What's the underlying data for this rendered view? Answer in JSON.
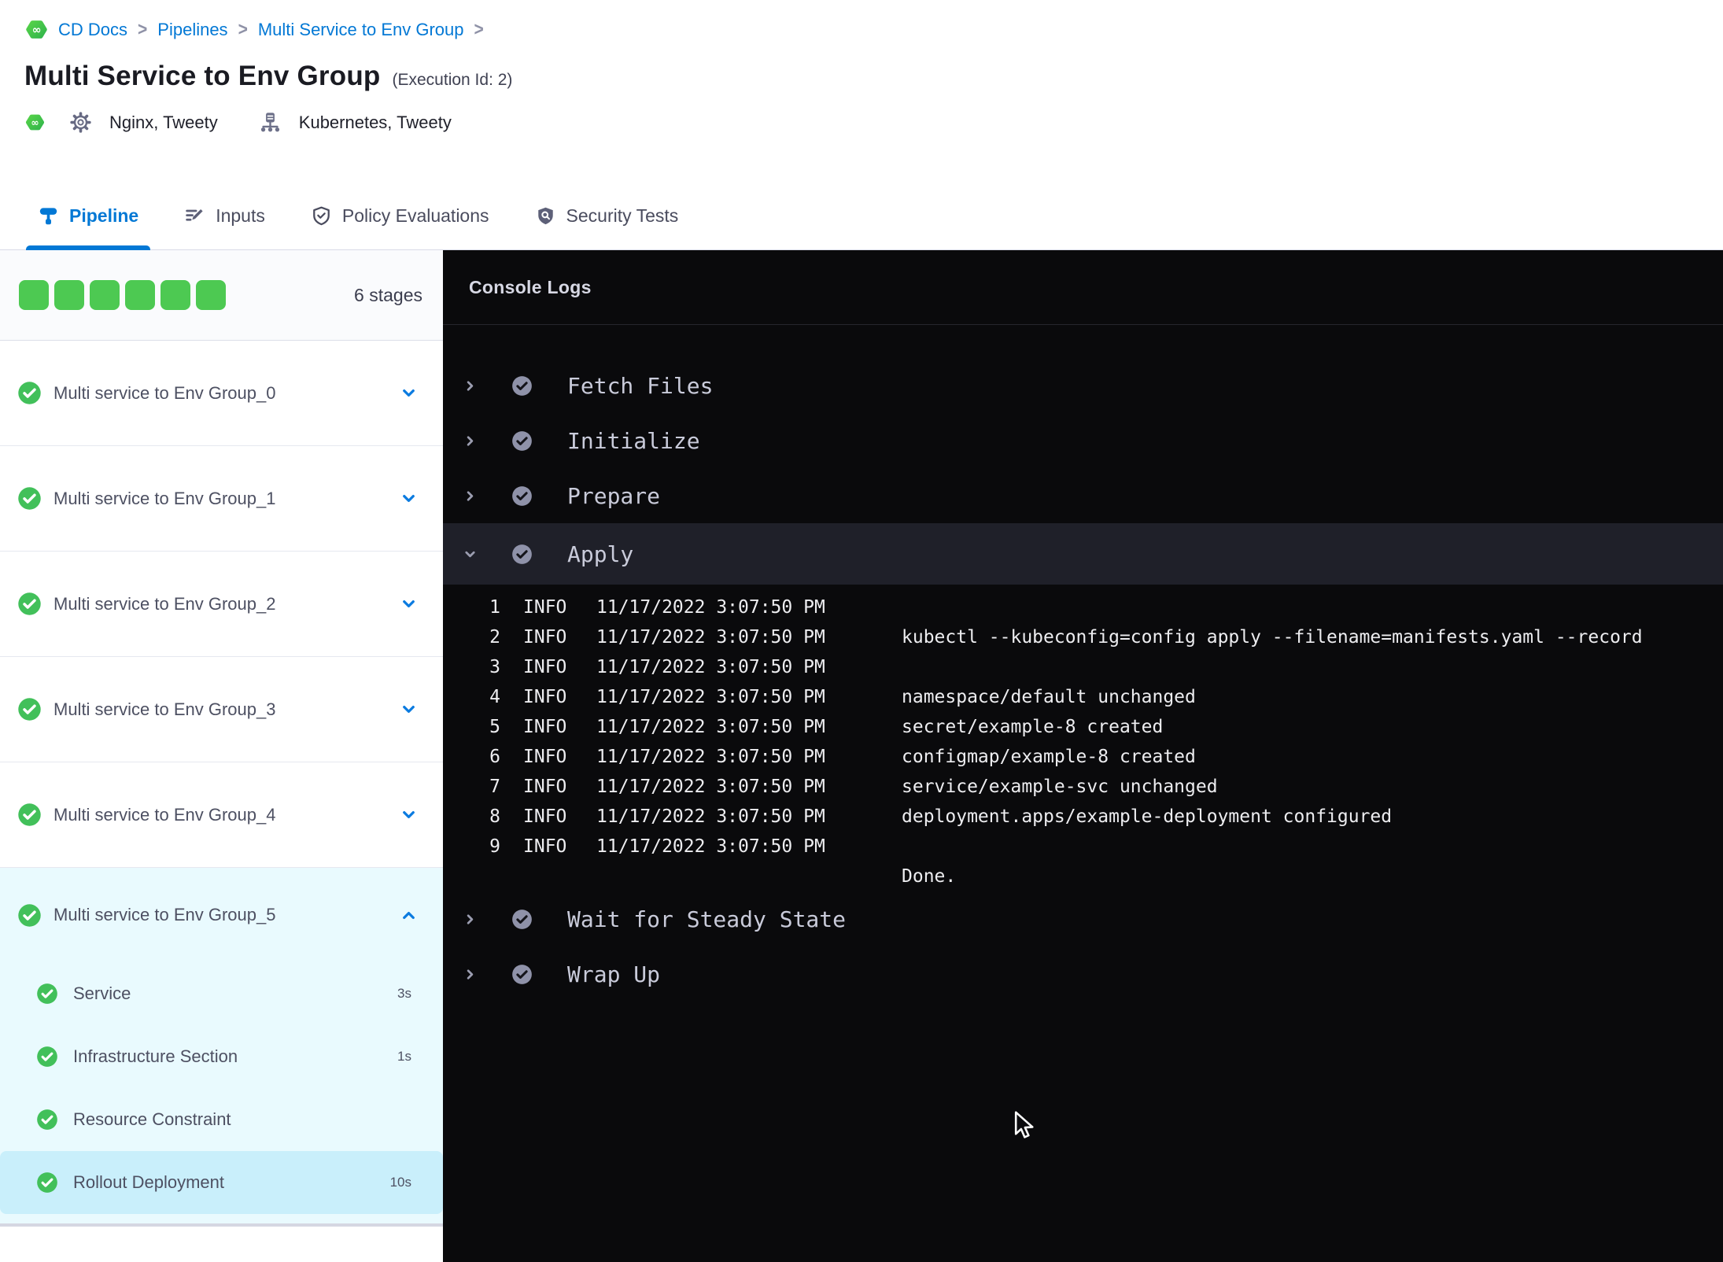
{
  "breadcrumb": {
    "items": [
      "CD Docs",
      "Pipelines",
      "Multi Service to Env Group"
    ],
    "separator": ">"
  },
  "header": {
    "title": "Multi Service to Env Group",
    "execution_id": "(Execution Id: 2)",
    "services": "Nginx, Tweety",
    "infrastructure": "Kubernetes, Tweety"
  },
  "tabs": [
    {
      "label": "Pipeline",
      "icon": "pipeline-icon",
      "active": true
    },
    {
      "label": "Inputs",
      "icon": "inputs-icon",
      "active": false
    },
    {
      "label": "Policy Evaluations",
      "icon": "shield-check-icon",
      "active": false
    },
    {
      "label": "Security Tests",
      "icon": "shield-search-icon",
      "active": false
    }
  ],
  "stages_summary": {
    "count": 6,
    "count_label": "6 stages"
  },
  "stages": [
    {
      "label": "Multi service to Env Group_0",
      "status": "success",
      "expanded": false
    },
    {
      "label": "Multi service to Env Group_1",
      "status": "success",
      "expanded": false
    },
    {
      "label": "Multi service to Env Group_2",
      "status": "success",
      "expanded": false
    },
    {
      "label": "Multi service to Env Group_3",
      "status": "success",
      "expanded": false
    },
    {
      "label": "Multi service to Env Group_4",
      "status": "success",
      "expanded": false
    },
    {
      "label": "Multi service to Env Group_5",
      "status": "success",
      "expanded": true,
      "steps": [
        {
          "label": "Service",
          "duration": "3s",
          "status": "success",
          "selected": false
        },
        {
          "label": "Infrastructure Section",
          "duration": "1s",
          "status": "success",
          "selected": false
        },
        {
          "label": "Resource Constraint",
          "duration": "",
          "status": "success",
          "selected": false
        },
        {
          "label": "Rollout Deployment",
          "duration": "10s",
          "status": "success",
          "selected": true
        }
      ]
    }
  ],
  "console": {
    "title": "Console Logs",
    "steps": [
      {
        "label": "Fetch Files",
        "status": "success",
        "expanded": false
      },
      {
        "label": "Initialize",
        "status": "success",
        "expanded": false
      },
      {
        "label": "Prepare",
        "status": "success",
        "expanded": false
      },
      {
        "label": "Apply",
        "status": "success",
        "expanded": true,
        "logs": [
          {
            "num": "1",
            "level": "INFO",
            "time": "11/17/2022 3:07:50 PM",
            "msg": ""
          },
          {
            "num": "2",
            "level": "INFO",
            "time": "11/17/2022 3:07:50 PM",
            "msg": "kubectl --kubeconfig=config apply --filename=manifests.yaml --record"
          },
          {
            "num": "3",
            "level": "INFO",
            "time": "11/17/2022 3:07:50 PM",
            "msg": ""
          },
          {
            "num": "4",
            "level": "INFO",
            "time": "11/17/2022 3:07:50 PM",
            "msg": "namespace/default unchanged"
          },
          {
            "num": "5",
            "level": "INFO",
            "time": "11/17/2022 3:07:50 PM",
            "msg": "secret/example-8 created"
          },
          {
            "num": "6",
            "level": "INFO",
            "time": "11/17/2022 3:07:50 PM",
            "msg": "configmap/example-8 created"
          },
          {
            "num": "7",
            "level": "INFO",
            "time": "11/17/2022 3:07:50 PM",
            "msg": "service/example-svc unchanged"
          },
          {
            "num": "8",
            "level": "INFO",
            "time": "11/17/2022 3:07:50 PM",
            "msg": "deployment.apps/example-deployment configured"
          },
          {
            "num": "9",
            "level": "INFO",
            "time": "11/17/2022 3:07:50 PM",
            "msg": ""
          },
          {
            "num": "",
            "level": "",
            "time": "",
            "msg": "Done."
          }
        ]
      },
      {
        "label": "Wait for Steady State",
        "status": "success",
        "expanded": false
      },
      {
        "label": "Wrap Up",
        "status": "success",
        "expanded": false
      }
    ]
  },
  "colors": {
    "accent_blue": "#0278d5",
    "success_green": "#4dc952",
    "stage_check_green": "#42c05a",
    "expanded_stage_bg": "#e9fafe",
    "selected_step_bg": "#c9effb",
    "console_bg": "#0a0a0c",
    "console_highlight_row": "#1f2029",
    "console_step_text": "#c9cbda",
    "console_check_gray": "#8f92a9"
  }
}
